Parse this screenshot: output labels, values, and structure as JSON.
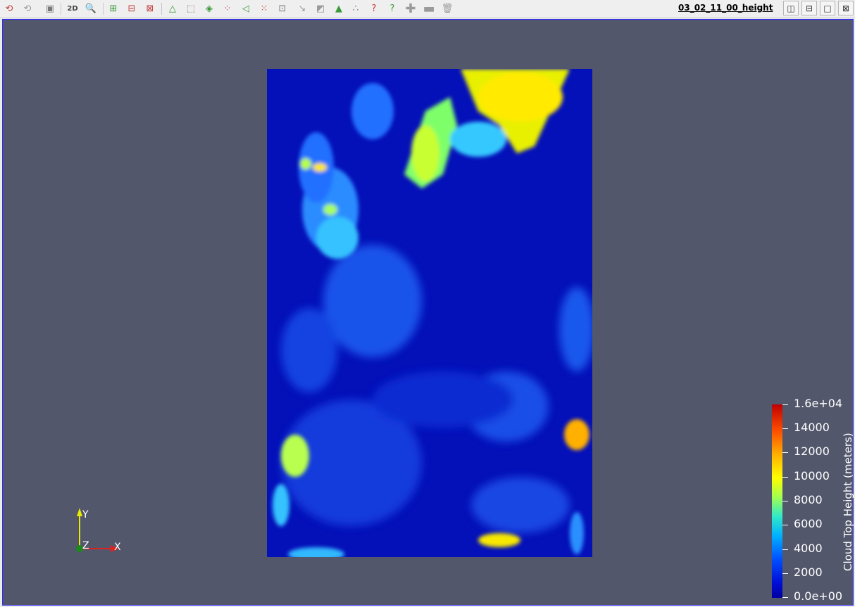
{
  "toolbar": {
    "buttons": [
      {
        "name": "reset-camera-icon"
      },
      {
        "name": "reset-camera-closest-icon"
      },
      {
        "name": "capture-screenshot-icon"
      },
      {
        "name": "toggle-2d-3d-icon",
        "label": "2D"
      },
      {
        "name": "zoom-to-box-icon"
      },
      {
        "name": "select-cells-on-icon"
      },
      {
        "name": "select-points-on-icon"
      },
      {
        "name": "select-cells-frustum-icon"
      },
      {
        "name": "select-points-frustum-icon"
      },
      {
        "name": "select-block-icon"
      },
      {
        "name": "interactive-select-cells-icon"
      },
      {
        "name": "interactive-select-points-icon"
      },
      {
        "name": "select-cells-polygon-icon"
      },
      {
        "name": "select-points-polygon-icon"
      },
      {
        "name": "hover-points-icon"
      },
      {
        "name": "grow-selection-icon"
      },
      {
        "name": "shrink-selection-icon"
      },
      {
        "name": "clear-selection-icon"
      }
    ],
    "view_title": "03_02_11_00_height"
  },
  "colorbar": {
    "title": "Cloud Top Height (meters)",
    "labels": [
      "1.6e+04",
      "14000",
      "12000",
      "10000",
      "8000",
      "6000",
      "4000",
      "2000",
      "0.0e+00"
    ],
    "colors": [
      "#0000a0",
      "#0050ff",
      "#00b0ff",
      "#a0ff50",
      "#ffff00",
      "#ffb000",
      "#ff5000",
      "#c00000"
    ]
  },
  "axes": {
    "x": "X",
    "y": "Y",
    "z": "Z"
  },
  "background_color": "#52576b"
}
